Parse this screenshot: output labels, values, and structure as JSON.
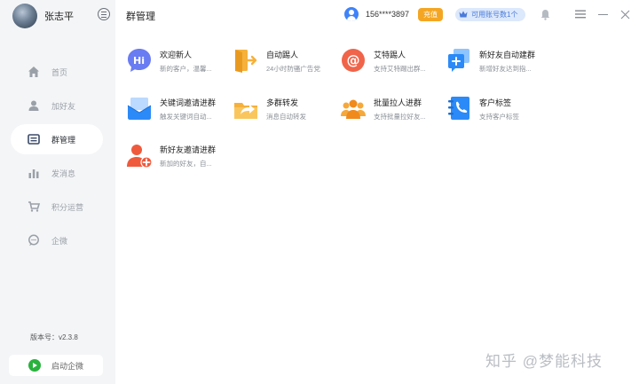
{
  "profile": {
    "name": "张志平"
  },
  "header": {
    "title": "群管理",
    "phone": "156****3897",
    "pay_label": "充值",
    "accounts_label": "可用账号数1个"
  },
  "sidebar": {
    "items": [
      {
        "label": "首页",
        "icon": "home-icon"
      },
      {
        "label": "加好友",
        "icon": "user-icon"
      },
      {
        "label": "群管理",
        "icon": "group-manage-icon",
        "active": true
      },
      {
        "label": "发消息",
        "icon": "chart-icon"
      },
      {
        "label": "积分运营",
        "icon": "cart-icon"
      },
      {
        "label": "企微",
        "icon": "chat-icon"
      }
    ],
    "version": "版本号：v2.3.8",
    "launch_label": "启动企微"
  },
  "features": [
    {
      "title": "欢迎新人",
      "desc": "新的客户，温馨...",
      "icon": "hi-icon"
    },
    {
      "title": "自动踢人",
      "desc": "24小时防骚广告党",
      "icon": "exit-door-icon"
    },
    {
      "title": "艾特踢人",
      "desc": "支持艾特踢出群...",
      "icon": "at-icon"
    },
    {
      "title": "新好友自动建群",
      "desc": "新增好友达到指...",
      "icon": "new-group-icon"
    },
    {
      "title": "关键词邀请进群",
      "desc": "触发关键词自动...",
      "icon": "mail-invite-icon"
    },
    {
      "title": "多群转发",
      "desc": "消息自动转发",
      "icon": "forward-folder-icon"
    },
    {
      "title": "批量拉人进群",
      "desc": "支持批量拉好友...",
      "icon": "batch-users-icon"
    },
    {
      "title": "客户标签",
      "desc": "支持客户标签",
      "icon": "contact-tag-icon"
    },
    {
      "title": "新好友邀请进群",
      "desc": "新加的好友，自...",
      "icon": "add-user-icon"
    }
  ],
  "watermark": "知乎 @梦能科技",
  "colors": {
    "accent_blue": "#3f83f8",
    "pay_orange": "#f4a623",
    "launch_green": "#29b23d",
    "sidebar_bg": "#f4f5f7"
  }
}
